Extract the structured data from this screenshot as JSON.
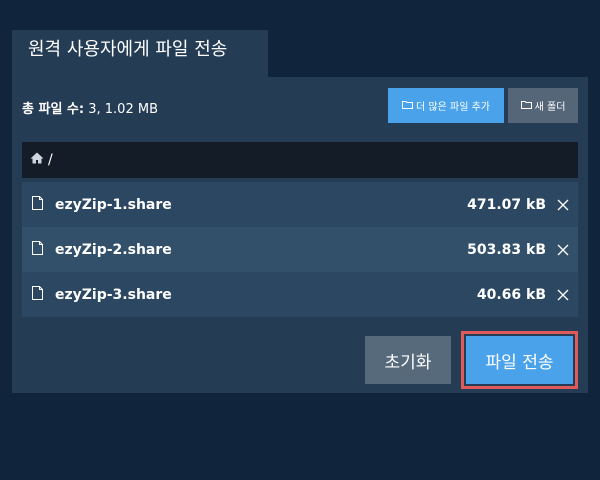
{
  "tab": {
    "title": "원격 사용자에게 파일 전송"
  },
  "summary": {
    "label": "총 파일 수:",
    "value": "3, 1.02 MB"
  },
  "toolbar": {
    "add_files_label": "더 많은 파일 추가",
    "new_folder_label": "새 폴더"
  },
  "path": {
    "current": "/"
  },
  "files": [
    {
      "name": "ezyZip-1.share",
      "size": "471.07 kB"
    },
    {
      "name": "ezyZip-2.share",
      "size": "503.83 kB"
    },
    {
      "name": "ezyZip-3.share",
      "size": "40.66 kB"
    }
  ],
  "actions": {
    "reset_label": "초기화",
    "send_label": "파일 전송"
  },
  "colors": {
    "background": "#10253b",
    "panel": "#243c54",
    "accent": "#4aa3ea",
    "highlight_border": "#e05a5a"
  }
}
